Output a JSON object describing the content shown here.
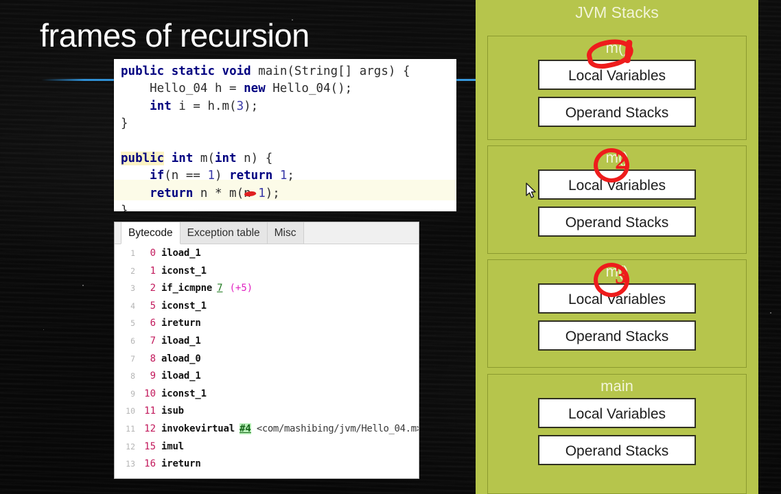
{
  "slide": {
    "title": "frames of recursion",
    "accent_blue": "#3a9ade",
    "background_color": "#0b0b0b"
  },
  "code_panel": {
    "language": "java",
    "lines": [
      {
        "tokens": [
          {
            "t": "public",
            "k": "kw"
          },
          {
            "t": " ",
            "k": "pln"
          },
          {
            "t": "static",
            "k": "kw"
          },
          {
            "t": " ",
            "k": "pln"
          },
          {
            "t": "void",
            "k": "kw"
          },
          {
            "t": " main(String[] args) {",
            "k": "pln"
          }
        ]
      },
      {
        "tokens": [
          {
            "t": "    Hello_04 h = ",
            "k": "pln"
          },
          {
            "t": "new",
            "k": "kw"
          },
          {
            "t": " Hello_04();",
            "k": "pln"
          }
        ]
      },
      {
        "tokens": [
          {
            "t": "    ",
            "k": "pln"
          },
          {
            "t": "int",
            "k": "kw"
          },
          {
            "t": " i = h.m(",
            "k": "pln"
          },
          {
            "t": "3",
            "k": "num"
          },
          {
            "t": ");",
            "k": "pln"
          }
        ]
      },
      {
        "tokens": [
          {
            "t": "}",
            "k": "pln"
          }
        ]
      },
      {
        "tokens": []
      },
      {
        "tokens": [
          {
            "t": "public",
            "k": "kw hl"
          },
          {
            "t": " ",
            "k": "pln"
          },
          {
            "t": "int",
            "k": "kw"
          },
          {
            "t": " m(",
            "k": "pln"
          },
          {
            "t": "int",
            "k": "kw"
          },
          {
            "t": " n) {",
            "k": "pln"
          }
        ]
      },
      {
        "tokens": [
          {
            "t": "    ",
            "k": "pln"
          },
          {
            "t": "if",
            "k": "kw"
          },
          {
            "t": "(n == ",
            "k": "pln"
          },
          {
            "t": "1",
            "k": "num"
          },
          {
            "t": ") ",
            "k": "pln"
          },
          {
            "t": "return",
            "k": "kw"
          },
          {
            "t": " ",
            "k": "pln"
          },
          {
            "t": "1",
            "k": "num"
          },
          {
            "t": ";",
            "k": "pln"
          }
        ]
      },
      {
        "tokens": [
          {
            "t": "    ",
            "k": "pln"
          },
          {
            "t": "return",
            "k": "kw"
          },
          {
            "t": " n * m(n-",
            "k": "pln"
          },
          {
            "t": "1",
            "k": "num"
          },
          {
            "t": ");",
            "k": "pln"
          }
        ]
      },
      {
        "tokens": [
          {
            "t": "}",
            "k": "pln"
          }
        ]
      }
    ]
  },
  "bytecode_panel": {
    "tabs": [
      {
        "label": "Bytecode",
        "active": true
      },
      {
        "label": "Exception table",
        "active": false
      },
      {
        "label": "Misc",
        "active": false
      }
    ],
    "rows": [
      {
        "line": "1",
        "offset": "0",
        "op": "iload_1"
      },
      {
        "line": "2",
        "offset": "1",
        "op": "iconst_1"
      },
      {
        "line": "3",
        "offset": "2",
        "op": "if_icmpne",
        "arg_link": "7",
        "arg_delta": "(+5)"
      },
      {
        "line": "4",
        "offset": "5",
        "op": "iconst_1"
      },
      {
        "line": "5",
        "offset": "6",
        "op": "ireturn"
      },
      {
        "line": "6",
        "offset": "7",
        "op": "iload_1"
      },
      {
        "line": "7",
        "offset": "8",
        "op": "aload_0"
      },
      {
        "line": "8",
        "offset": "9",
        "op": "iload_1"
      },
      {
        "line": "9",
        "offset": "10",
        "op": "iconst_1"
      },
      {
        "line": "10",
        "offset": "11",
        "op": "isub"
      },
      {
        "line": "11",
        "offset": "12",
        "op": "invokevirtual",
        "arg_hl": "#4",
        "arg_ref": "<com/mashibing/jvm/Hello_04.m>"
      },
      {
        "line": "12",
        "offset": "15",
        "op": "imul"
      },
      {
        "line": "13",
        "offset": "16",
        "op": "ireturn"
      }
    ]
  },
  "jvm_stacks": {
    "title": "JVM Stacks",
    "panel_color": "#b6c54c",
    "frames": [
      {
        "label": "m()",
        "annotation": "1",
        "slots": [
          "Local Variables",
          "Operand Stacks"
        ]
      },
      {
        "label": "m()",
        "annotation": "2",
        "slots": [
          "Local Variables",
          "Operand Stacks"
        ]
      },
      {
        "label": "m()",
        "annotation": "3",
        "slots": [
          "Local Variables",
          "Operand Stacks"
        ]
      },
      {
        "label": "main",
        "annotation": "",
        "slots": [
          "Local Variables",
          "Operand Stacks"
        ]
      }
    ]
  },
  "annotations": {
    "pen_color": "#ee1c1c"
  }
}
